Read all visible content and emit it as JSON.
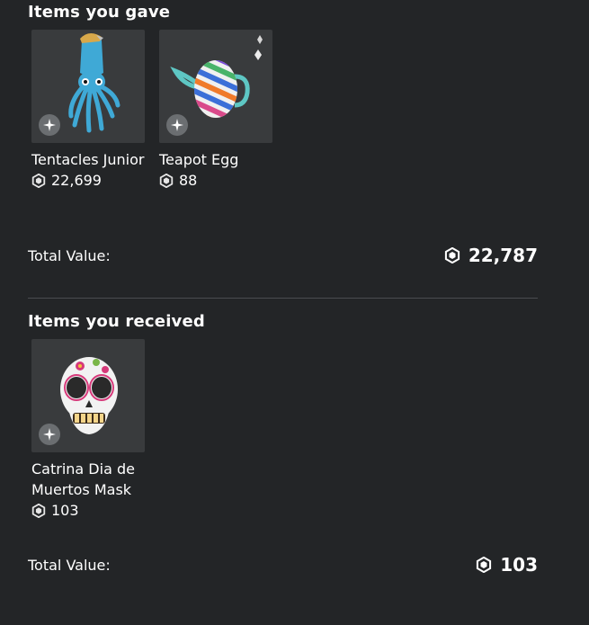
{
  "gave": {
    "title": "Items you gave",
    "items": [
      {
        "name": "Tentacles Junior",
        "price": "22,699",
        "icon": "limited-icon"
      },
      {
        "name": "Teapot Egg",
        "price": "88",
        "icon": "limited-icon"
      }
    ],
    "total_label": "Total Value:",
    "total_value": "22,787"
  },
  "received": {
    "title": "Items you received",
    "items": [
      {
        "name": "Catrina Dia de Muertos Mask",
        "price": "103",
        "icon": "limited-icon"
      }
    ],
    "total_label": "Total Value:",
    "total_value": "103"
  },
  "currency_icon": "robux-icon",
  "colors": {
    "background": "#232527",
    "card_background": "#393b3d",
    "divider": "#4a4c4f",
    "text": "#ffffff"
  }
}
